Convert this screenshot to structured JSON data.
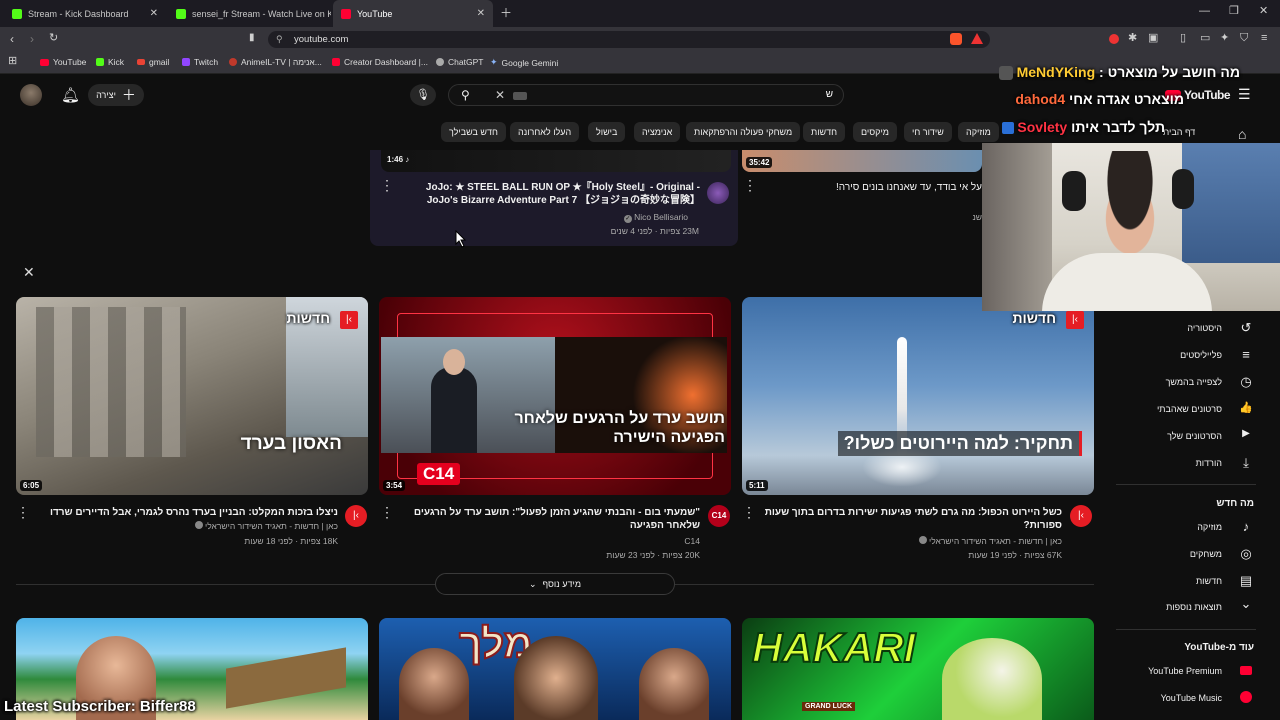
{
  "browser": {
    "tabs": [
      {
        "label": "Stream - Kick Dashboard",
        "color": "#53fc18"
      },
      {
        "label": "sensei_fr Stream - Watch Live on Kick",
        "color": "#53fc18"
      },
      {
        "label": "YouTube",
        "color": "#ff0033"
      }
    ],
    "url": "youtube.com",
    "bookmarks": [
      {
        "label": "YouTube",
        "color": "#ff0033"
      },
      {
        "label": "Kick",
        "color": "#53fc18"
      },
      {
        "label": "gmail",
        "color": "#ea4335"
      },
      {
        "label": "Twitch",
        "color": "#9146ff"
      },
      {
        "label": "AnimeIL-TV | אנימה...",
        "color": "#c0392b"
      },
      {
        "label": "Creator Dashboard |...",
        "color": "#ff0033"
      },
      {
        "label": "ChatGPT",
        "color": "#aaaaaa"
      },
      {
        "label": "Google Gemini",
        "color": "#8ab4f8"
      }
    ]
  },
  "header": {
    "create_label": "יצירה",
    "search_value": "ש",
    "logo_text": "YouTube",
    "logo_region": "IL"
  },
  "chips": [
    "דף הבית",
    "מוזיקה",
    "שידור חי",
    "מיקסים",
    "חדשות",
    "משחקי פעולה והרפתקאות",
    "אנימציה",
    "בישול",
    "העלו לאחרונה",
    "חדש בשבילך"
  ],
  "top_videos": [
    {
      "duration": "1:46",
      "title": "JoJo: ★ STEEL BALL RUN OP ★『Holy Steel』- Original - JoJo's Bizarre Adventure Part 7 【ジョジョの奇妙な冒険】",
      "channel": "Nico Bellisario",
      "meta": "23M צפיות · לפני 4 שנים"
    },
    {
      "duration": "35:42",
      "title": "על אי בודד, עד שאנחנו בונים סירה!",
      "channel": "",
      "meta": "שנ"
    }
  ],
  "news_shelf": {
    "more_label": "מידע נוסף",
    "news_tag": "חדשות",
    "videos": [
      {
        "duration": "6:05",
        "overlay": "האסון בערד",
        "title": "ניצלו בזכות המקלט: הבניין בערד נהרס לגמרי, אבל הדיירים שרדו",
        "channel": "כאן | חדשות - תאגיד השידור הישראלי",
        "meta": "18K צפיות · לפני 18 שעות"
      },
      {
        "duration": "3:54",
        "overlay": "תושב ערד על הרגעים שלאחר הפגיעה הישירה",
        "badge": "C14",
        "title": "\"שמעתי בום - והבנתי שהגיע הזמן לפעול\": תושב ערד על הרגעים שלאחר הפגיעה",
        "channel": "C14",
        "meta": "20K צפיות · לפני 23 שעות"
      },
      {
        "duration": "5:11",
        "overlay": "תחקיר: למה היירוטים כשלו?",
        "title": "כשל היירוט הכפול: מה גרם לשתי פגיעות ישירות בדרום בתוך שעות ספורות?",
        "channel": "כאן | חדשות - תאגיד השידור הישראלי",
        "meta": "67K צפיות · לפני 19 שעות"
      }
    ]
  },
  "bottom_thumbs": [
    {
      "text": ""
    },
    {
      "text": "מלך"
    },
    {
      "text": "HAKARI",
      "sub": "GRAND LUCK"
    }
  ],
  "sidebar": {
    "items1": [
      {
        "label": "היסטוריה",
        "icon": "history-icon",
        "glyph": "↺"
      },
      {
        "label": "פלייליסטים",
        "icon": "playlists-icon",
        "glyph": "≡"
      },
      {
        "label": "לצפייה בהמשך",
        "icon": "watch-later-icon",
        "glyph": "◷"
      },
      {
        "label": "סרטונים שאהבתי",
        "icon": "like-icon",
        "glyph": "👍"
      },
      {
        "label": "הסרטונים שלך",
        "icon": "your-videos-icon",
        "glyph": "▶"
      },
      {
        "label": "הורדות",
        "icon": "download-icon",
        "glyph": "⤓"
      }
    ],
    "explore_title": "מה חדש",
    "items2": [
      {
        "label": "מוזיקה",
        "icon": "music-icon",
        "glyph": "♪"
      },
      {
        "label": "משחקים",
        "icon": "gaming-icon",
        "glyph": "◎"
      },
      {
        "label": "חדשות",
        "icon": "news-icon",
        "glyph": "▤"
      },
      {
        "label": "תוצאות נוספות",
        "icon": "chevron-down-icon",
        "glyph": "⌄"
      }
    ],
    "more_title": "עוד מ-YouTube",
    "items3": [
      {
        "label": "YouTube Premium",
        "icon": "yt-premium-icon"
      },
      {
        "label": "YouTube Music",
        "icon": "yt-music-icon"
      }
    ]
  },
  "stream_overlay": {
    "chat": [
      {
        "user": "MeNdYKing",
        "message": "מה חושב על מוצארט"
      },
      {
        "user": "dahod4",
        "message": "מוצארט אגדה אחי"
      },
      {
        "user": "Sovlety",
        "message": "תלך לדבר איתו"
      }
    ],
    "latest_subscriber_label": "Latest Subscriber:",
    "latest_subscriber_name": "Biffer88"
  }
}
